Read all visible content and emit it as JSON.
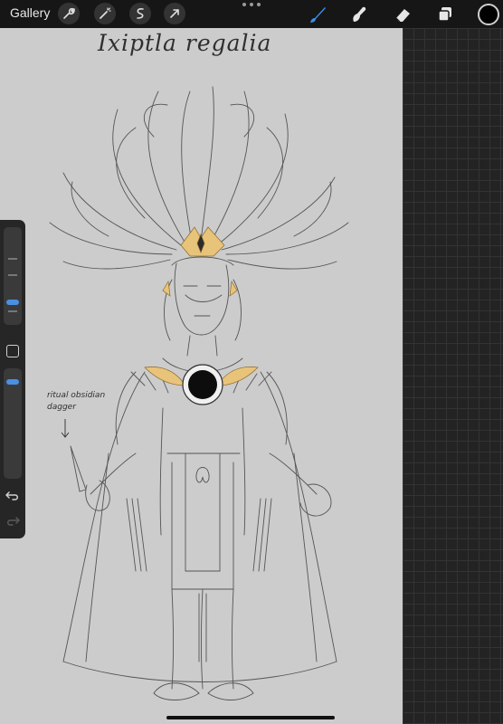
{
  "topbar": {
    "gallery_label": "Gallery",
    "left_tools": [
      "wrench-icon",
      "magic-wand-icon",
      "selection-icon",
      "transform-arrow-icon"
    ],
    "right_tools": [
      "brush-icon",
      "smudge-icon",
      "eraser-icon",
      "layers-icon"
    ],
    "active_tool": "brush-icon",
    "accent_color": "#3a8ee6",
    "current_color": "#000000"
  },
  "canvas": {
    "title": "Ixiptla regalia",
    "annotation": "ritual obsidian dagger",
    "background": "#cccccc",
    "gold_accent": "#e8c37a"
  },
  "sidebar": {
    "brush_size_slider": "size-slider",
    "opacity_slider": "opacity-slider",
    "modify_button": "modify-button",
    "undo": "undo-icon",
    "redo": "redo-icon"
  }
}
